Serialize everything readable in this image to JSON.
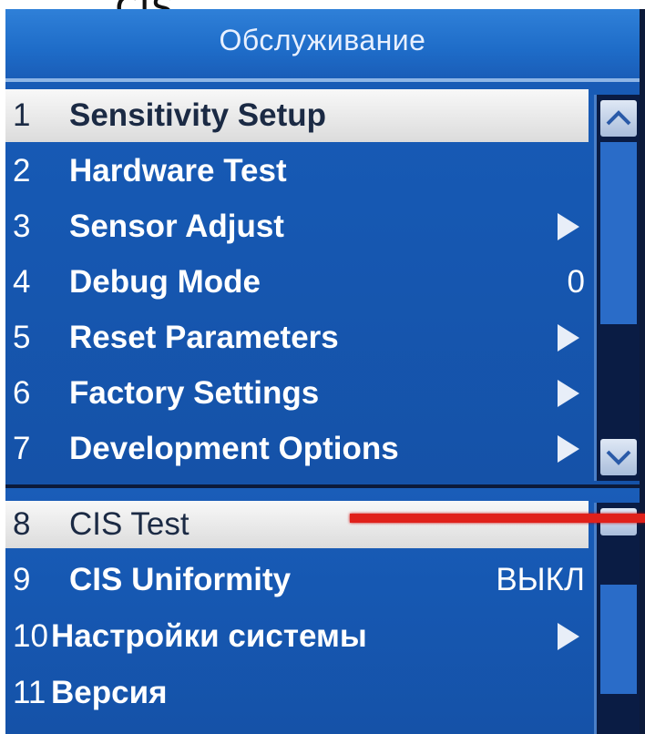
{
  "caption": "cis",
  "header": {
    "title": "Обслуживание"
  },
  "menu": {
    "items": [
      {
        "num": "1",
        "label": "Sensitivity Setup",
        "value": "",
        "arrow": false
      },
      {
        "num": "2",
        "label": "Hardware Test",
        "value": "",
        "arrow": false
      },
      {
        "num": "3",
        "label": "Sensor Adjust",
        "value": "",
        "arrow": true
      },
      {
        "num": "4",
        "label": "Debug Mode",
        "value": "0",
        "arrow": false
      },
      {
        "num": "5",
        "label": "Reset Parameters",
        "value": "",
        "arrow": true
      },
      {
        "num": "6",
        "label": "Factory Settings",
        "value": "",
        "arrow": true
      },
      {
        "num": "7",
        "label": "Development Options",
        "value": "",
        "arrow": true
      },
      {
        "num": "8",
        "label": "CIS Test",
        "value": "",
        "arrow": false
      },
      {
        "num": "9",
        "label": "CIS Uniformity",
        "value": "ВЫКЛ",
        "arrow": false
      },
      {
        "num": "10",
        "label": "Настройки системы",
        "value": "",
        "arrow": true
      },
      {
        "num": "11",
        "label": "Версия",
        "value": "",
        "arrow": false
      }
    ]
  },
  "colors": {
    "accent": "#1a5db8",
    "selection": "#e6e6e6",
    "pointer": "#e0201a"
  }
}
